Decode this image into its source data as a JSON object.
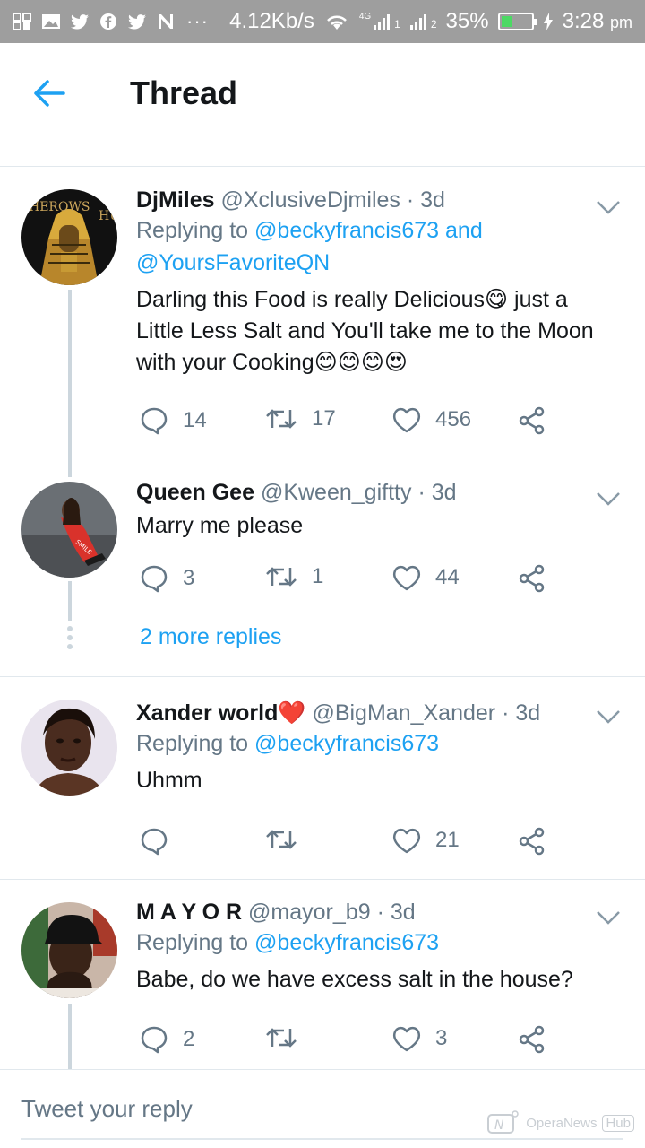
{
  "status_bar": {
    "network_speed": "4.12Kb/s",
    "signal_1": "4G",
    "sim_1": "1",
    "sim_2": "2",
    "battery": "35%",
    "battery_level": 0.35,
    "time": "3:28",
    "ampm": "pm",
    "more": "···"
  },
  "header": {
    "title": "Thread"
  },
  "tweets": [
    {
      "name": "DjMiles",
      "handle": "@XclusiveDjmiles",
      "time": "· 3d",
      "replying_prefix": "Replying to",
      "replying_to": "@beckyfrancis673 and @YoursFavoriteQN",
      "text": "Darling this Food is really Delicious😋 just a Little Less Salt and You'll take me to the Moon with your Cooking😊😊😊😍",
      "replies": "14",
      "retweets": "17",
      "likes": "456"
    },
    {
      "name": "Queen Gee",
      "handle": "@Kween_giftty",
      "time": "· 3d",
      "text": "Marry me please",
      "replies": "3",
      "retweets": "1",
      "likes": "44"
    },
    {
      "name": "Xander world❤️",
      "handle": "@BigMan_Xander",
      "time": "· 3d",
      "replying_prefix": "Replying to",
      "replying_to": "@beckyfrancis673",
      "text": "Uhmm",
      "replies": "",
      "retweets": "",
      "likes": "21"
    },
    {
      "name": "M A Y O R",
      "handle": "@mayor_b9",
      "time": "· 3d",
      "replying_prefix": "Replying to",
      "replying_to": "@beckyfrancis673",
      "text": "Babe, do we have excess salt in the house?",
      "replies": "2",
      "retweets": "",
      "likes": "3"
    }
  ],
  "more_replies": "2 more replies",
  "reply_bar": {
    "placeholder": "Tweet your reply"
  },
  "watermark": {
    "brand": "OperaNews",
    "hub": "Hub"
  },
  "colors": {
    "accent": "#1da1f2",
    "muted": "#657786",
    "divider": "#e1e8ed",
    "status_bar": "#9e9e9e"
  }
}
